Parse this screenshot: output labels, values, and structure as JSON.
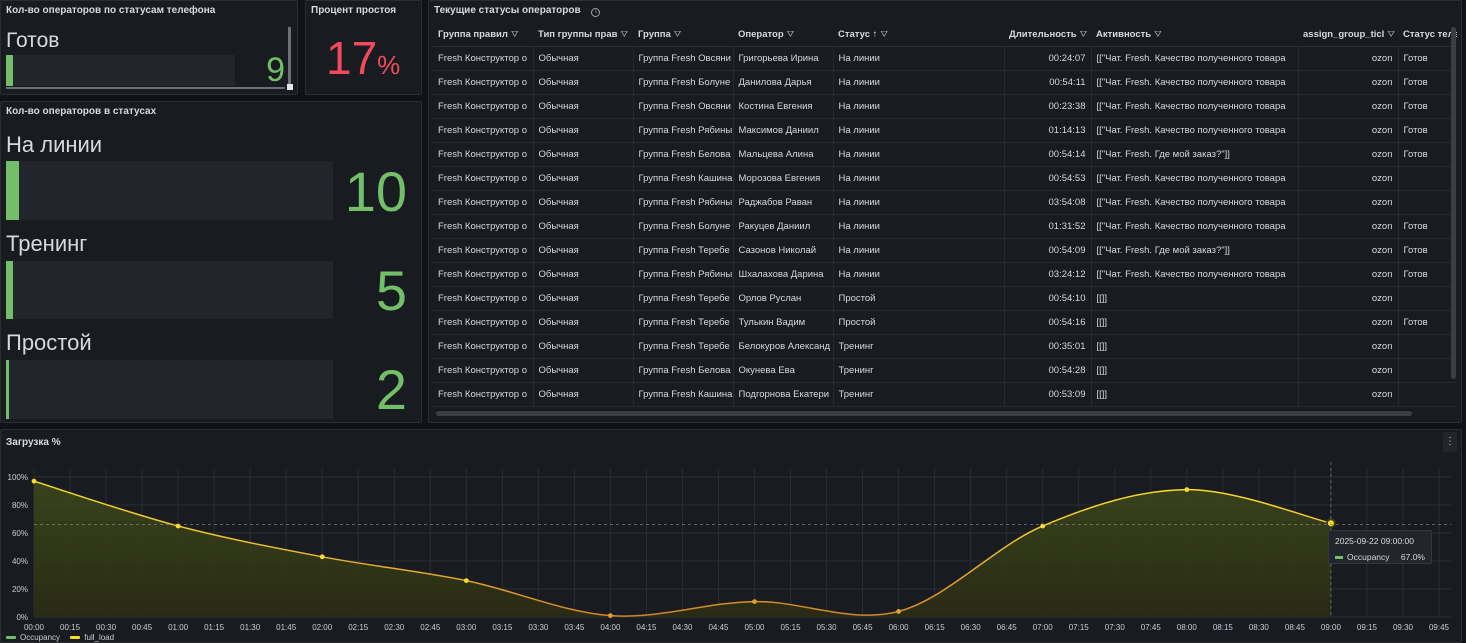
{
  "panel_phone_status": {
    "title": "Кол-во операторов по статусам телефона",
    "label": "Готов",
    "value": "9",
    "fill": 0.03
  },
  "panel_idle": {
    "title": "Процент простоя",
    "value": "17",
    "unit": "%",
    "color": "#f2495c"
  },
  "panel_statuses": {
    "title": "Кол-во операторов в статусах",
    "items": [
      {
        "label": "На линии",
        "value": "10",
        "fill": 0.04
      },
      {
        "label": "Тренинг",
        "value": "5",
        "fill": 0.02
      },
      {
        "label": "Простой",
        "value": "2",
        "fill": 0.01
      }
    ]
  },
  "table": {
    "title": "Текущие статусы операторов",
    "columns": [
      "Группа правил",
      "Тип группы прав",
      "Группа",
      "Оператор",
      "Статус",
      "Длительность",
      "Активность",
      "assign_group_ticl",
      "Статус теле"
    ],
    "sort_indicator": "↑",
    "rows": [
      [
        "Fresh Конструктор о",
        "Обычная",
        "Группа Fresh Овсяни",
        "Григорьева Ирина",
        "На линии",
        "00:24:07",
        "[[\"Чат. Fresh. Качество полученного товара",
        "ozon",
        "Готов"
      ],
      [
        "Fresh Конструктор о",
        "Обычная",
        "Группа Fresh Болуне",
        "Данилова Дарья",
        "На линии",
        "00:54:11",
        "[[\"Чат. Fresh. Качество полученного товара",
        "ozon",
        "Готов"
      ],
      [
        "Fresh Конструктор о",
        "Обычная",
        "Группа Fresh Овсяни",
        "Костина Евгения",
        "На линии",
        "00:23:38",
        "[[\"Чат. Fresh. Качество полученного товара",
        "ozon",
        "Готов"
      ],
      [
        "Fresh Конструктор о",
        "Обычная",
        "Группа Fresh Рябины",
        "Максимов Даниил",
        "На линии",
        "01:14:13",
        "[[\"Чат. Fresh. Качество полученного товара",
        "ozon",
        "Готов"
      ],
      [
        "Fresh Конструктор о",
        "Обычная",
        "Группа Fresh Белова",
        "Мальцева Алина",
        "На линии",
        "00:54:14",
        "[[\"Чат. Fresh. Где мой заказ?\"]]",
        "ozon",
        "Готов"
      ],
      [
        "Fresh Конструктор о",
        "Обычная",
        "Группа Fresh Кашина",
        "Морозова Евгения",
        "На линии",
        "00:54:53",
        "[[\"Чат. Fresh. Качество полученного товара",
        "ozon",
        ""
      ],
      [
        "Fresh Конструктор о",
        "Обычная",
        "Группа Fresh Рябины",
        "Раджабов Раван",
        "На линии",
        "03:54:08",
        "[[\"Чат. Fresh. Качество полученного товара",
        "ozon",
        ""
      ],
      [
        "Fresh Конструктор о",
        "Обычная",
        "Группа Fresh Болуне",
        "Ракуцев Даниил",
        "На линии",
        "01:31:52",
        "[[\"Чат. Fresh. Качество полученного товара",
        "ozon",
        "Готов"
      ],
      [
        "Fresh Конструктор о",
        "Обычная",
        "Группа Fresh Теребе",
        "Сазонов Николай",
        "На линии",
        "00:54:09",
        "[[\"Чат. Fresh. Где мой заказ?\"]]",
        "ozon",
        "Готов"
      ],
      [
        "Fresh Конструктор о",
        "Обычная",
        "Группа Fresh Рябины",
        "Шхалахова Дарина",
        "На линии",
        "03:24:12",
        "[[\"Чат. Fresh. Качество полученного товара",
        "ozon",
        "Готов"
      ],
      [
        "Fresh Конструктор о",
        "Обычная",
        "Группа Fresh Теребе",
        "Орлов Руслан",
        "Простой",
        "00:54:10",
        "[[]]",
        "ozon",
        ""
      ],
      [
        "Fresh Конструктор о",
        "Обычная",
        "Группа Fresh Теребе",
        "Тулькин Вадим",
        "Простой",
        "00:54:16",
        "[[]]",
        "ozon",
        "Готов"
      ],
      [
        "Fresh Конструктор о",
        "Обычная",
        "Группа Fresh Теребе",
        "Белокуров Александ",
        "Тренинг",
        "00:35:01",
        "[[]]",
        "ozon",
        ""
      ],
      [
        "Fresh Конструктор о",
        "Обычная",
        "Группа Fresh Белова",
        "Окунева Ева",
        "Тренинг",
        "00:54:28",
        "[[]]",
        "ozon",
        ""
      ],
      [
        "Fresh Конструктор о",
        "Обычная",
        "Группа Fresh Кашина",
        "Подгорнова Екатери",
        "Тренинг",
        "00:53:09",
        "[[]]",
        "ozon",
        ""
      ]
    ]
  },
  "chart_panel": {
    "title": "Загрузка %"
  },
  "chart_data": {
    "type": "line",
    "ylim": [
      0,
      100
    ],
    "yticks": [
      "0%",
      "20%",
      "40%",
      "60%",
      "80%",
      "100%"
    ],
    "xticks": [
      "00:00",
      "00:15",
      "00:30",
      "00:45",
      "01:00",
      "01:15",
      "01:30",
      "01:45",
      "02:00",
      "02:15",
      "02:30",
      "02:45",
      "03:00",
      "03:15",
      "03:30",
      "03:45",
      "04:00",
      "04:15",
      "04:30",
      "04:45",
      "05:00",
      "05:15",
      "05:30",
      "05:45",
      "06:00",
      "06:15",
      "06:30",
      "06:45",
      "07:00",
      "07:15",
      "07:30",
      "07:45",
      "08:00",
      "08:15",
      "08:30",
      "08:45",
      "09:00",
      "09:15",
      "09:30",
      "09:45"
    ],
    "series": [
      {
        "name": "Occupancy",
        "x": [
          "00:00",
          "01:00",
          "02:00",
          "03:00",
          "04:00",
          "05:00",
          "06:00",
          "07:00",
          "08:00",
          "09:00"
        ],
        "values": [
          97,
          65,
          43,
          26,
          1,
          11,
          4,
          65,
          91,
          67
        ],
        "color": "#fade2a"
      }
    ],
    "threshold": 66,
    "legend": [
      {
        "name": "Occupancy",
        "color": "#73bf69"
      },
      {
        "name": "full_load",
        "color": "#fade2a"
      }
    ],
    "tooltip": {
      "time": "2025-09-22 09:00:00",
      "series": "Occupancy",
      "value": "67.0%"
    }
  }
}
